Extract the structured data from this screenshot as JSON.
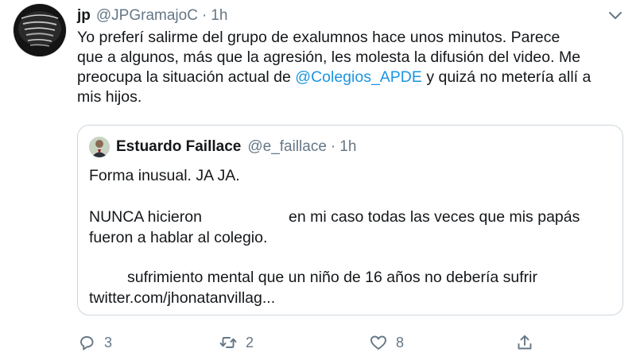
{
  "tweet": {
    "author_name": "jp",
    "author_handle": "@JPGramajoC",
    "separator": "·",
    "time": "1h",
    "text_lines": [
      "Yo preferí salirme del grupo de exalumnos hace unos minutos. Parece",
      "que a algunos, más que la agresión, les molesta la difusión del video. Me",
      "preocupa la situación actual de ",
      "@Colegios_APDE",
      " y quizá no metería allí a",
      "mis hijos."
    ]
  },
  "quoted_tweet": {
    "author_name": "Estuardo Faillace",
    "author_handle": "@e_faillace",
    "separator": "·",
    "time": "1h",
    "lines": {
      "l1": "Forma inusual. JA JA.",
      "l2a": "NUNCA hicieron",
      "l2b": "en mi caso todas las veces que mis papás",
      "l3": "fueron a hablar al colegio.",
      "l4": "sufrimiento mental que un niño de 16 años no debería sufrir",
      "l5": "twitter.com/jhonatanvillag..."
    }
  },
  "actions": {
    "reply_count": "3",
    "retweet_count": "2",
    "like_count": "8"
  },
  "icons": {
    "more": "chevron-down-icon",
    "reply": "reply-icon",
    "retweet": "retweet-icon",
    "like": "heart-icon",
    "share": "share-icon"
  },
  "colors": {
    "text": "#14171a",
    "secondary": "#657786",
    "link": "#1b95e0",
    "border": "#ccd6dd"
  }
}
